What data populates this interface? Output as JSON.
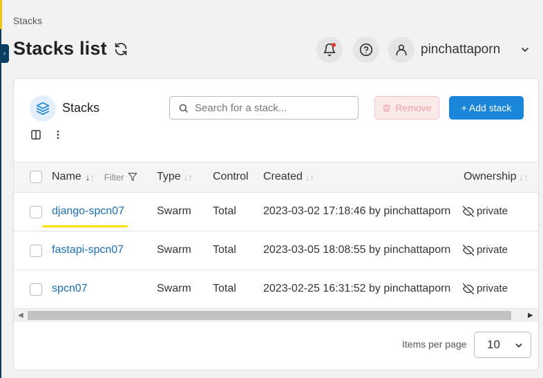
{
  "breadcrumb": "Stacks",
  "page": {
    "title": "Stacks list"
  },
  "header": {
    "username": "pinchattaporn"
  },
  "card": {
    "title": "Stacks",
    "search_placeholder": "Search for a stack...",
    "remove_label": "Remove",
    "add_label": "+ Add stack"
  },
  "table": {
    "columns": {
      "name": "Name",
      "filter": "Filter",
      "type": "Type",
      "control": "Control",
      "created": "Created",
      "ownership": "Ownership"
    },
    "rows": [
      {
        "name": "django-spcn07",
        "type": "Swarm",
        "control": "Total",
        "created": "2023-03-02 17:18:46 by pinchattaporn",
        "ownership": "private"
      },
      {
        "name": "fastapi-spcn07",
        "type": "Swarm",
        "control": "Total",
        "created": "2023-03-05 18:08:55 by pinchattaporn",
        "ownership": "private"
      },
      {
        "name": "spcn07",
        "type": "Swarm",
        "control": "Total",
        "created": "2023-02-25 16:31:52 by pinchattaporn",
        "ownership": "private"
      }
    ]
  },
  "pagination": {
    "label": "Items per page",
    "value": "10"
  },
  "colors": {
    "primary": "#1a86d9",
    "link": "#1a6fb5",
    "highlight": "#ffe100",
    "sidebar": "#0a3d62"
  }
}
